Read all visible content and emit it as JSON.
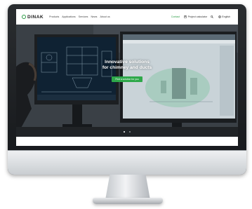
{
  "header": {
    "logo": "DINAK",
    "nav": [
      "Products",
      "Applications",
      "Services",
      "News",
      "About us"
    ],
    "contact": "Contact",
    "project": "Project calculator",
    "language": "English"
  },
  "hero": {
    "title_line1": "Innovative solutions",
    "title_line2": "for chimney and ducts",
    "cta": "Find a solution for you",
    "slides": 2,
    "active_slide": 1
  },
  "icons": [
    "dinak-logo-icon",
    "calculator-icon",
    "search-icon",
    "globe-icon"
  ],
  "colors": {
    "brand_green": "#2ea84a",
    "header_bg": "#ffffff",
    "hero_bg": "#2f3439"
  }
}
